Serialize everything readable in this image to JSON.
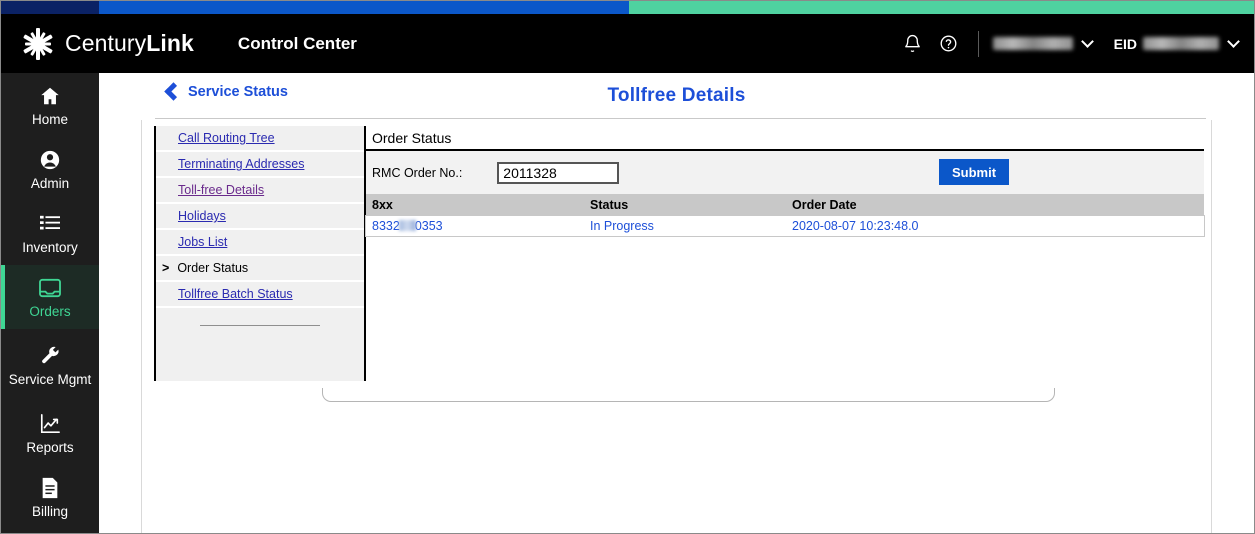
{
  "window": {
    "accent_colors": [
      "#0b2265",
      "#0b57c9",
      "#4fd2a0"
    ],
    "brand_black": "#000000",
    "link_blue": "#1d4fd8",
    "active_green": "#3fd694"
  },
  "header": {
    "brand_century": "Century",
    "brand_link": "Link",
    "app_title": "Control Center",
    "notifications_icon": "bell-icon",
    "help_icon": "help-circle-icon",
    "account_name": "",
    "eid_label": "EID",
    "eid_value": "",
    "chevron_icon": "chevron-down-icon"
  },
  "sidebar": {
    "items": [
      {
        "label": "Home",
        "icon": "home-icon",
        "active": false
      },
      {
        "label": "Admin",
        "icon": "user-circle-icon",
        "active": false
      },
      {
        "label": "Inventory",
        "icon": "list-icon",
        "active": false
      },
      {
        "label": "Orders",
        "icon": "inbox-tray-icon",
        "active": true
      },
      {
        "label": "Service Mgmt",
        "icon": "wrench-icon",
        "active": false
      },
      {
        "label": "Reports",
        "icon": "chart-line-icon",
        "active": false
      },
      {
        "label": "Billing",
        "icon": "invoice-icon",
        "active": false
      }
    ]
  },
  "content": {
    "back_link": "Service Status",
    "back_icon": "chevron-left-icon",
    "page_title": "Tollfree Details"
  },
  "sub_nav": {
    "items": [
      {
        "label": "Call Routing Tree",
        "current": false,
        "visited": false
      },
      {
        "label": "Terminating Addresses",
        "current": false,
        "visited": false
      },
      {
        "label": "Toll-free Details",
        "current": false,
        "visited": true
      },
      {
        "label": "Holidays",
        "current": false,
        "visited": false
      },
      {
        "label": "Jobs List",
        "current": false,
        "visited": false
      },
      {
        "label": "Order Status",
        "current": true,
        "visited": false,
        "marker": ">"
      },
      {
        "label": "Tollfree Batch Status",
        "current": false,
        "visited": false
      }
    ]
  },
  "order_status_panel": {
    "heading": "Order Status",
    "form": {
      "rmc_label": "RMC Order No.:",
      "rmc_value": "2011328",
      "rmc_placeholder": "",
      "submit_label": "Submit"
    },
    "table": {
      "headers": [
        "8xx",
        "Status",
        "Order Date"
      ],
      "rows": [
        {
          "number_prefix": "8332",
          "number_suffix": "0353",
          "number_redacted": true,
          "status": "In Progress",
          "order_date": "2020-08-07 10:23:48.0"
        }
      ]
    }
  }
}
